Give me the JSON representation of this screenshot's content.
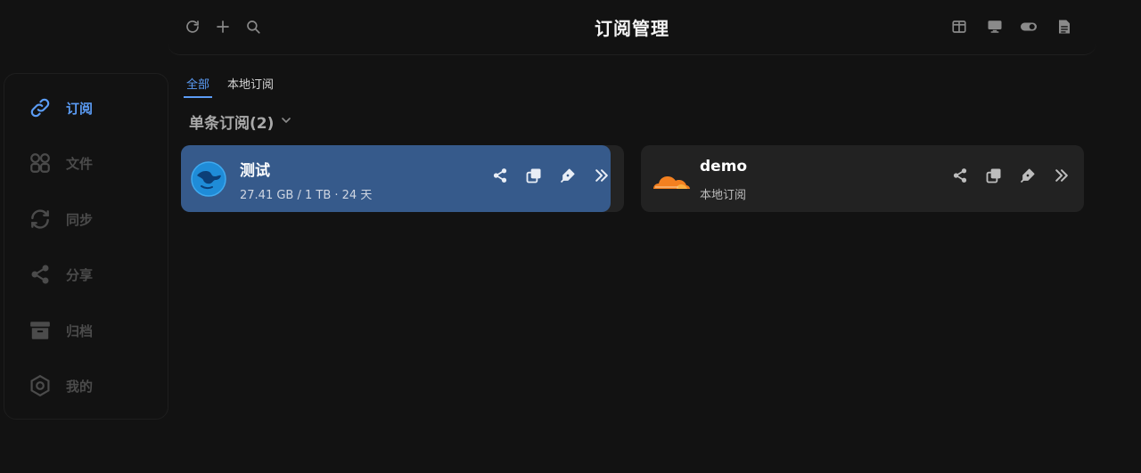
{
  "header": {
    "title": "订阅管理"
  },
  "sidebar": {
    "items": [
      {
        "label": "订阅",
        "icon": "link-icon",
        "active": true
      },
      {
        "label": "文件",
        "icon": "grid-icon",
        "active": false
      },
      {
        "label": "同步",
        "icon": "sync-icon",
        "active": false
      },
      {
        "label": "分享",
        "icon": "share-icon",
        "active": false
      },
      {
        "label": "归档",
        "icon": "archive-icon",
        "active": false
      },
      {
        "label": "我的",
        "icon": "hexagon-icon",
        "active": false
      }
    ]
  },
  "tabs": [
    {
      "label": "全部",
      "active": true
    },
    {
      "label": "本地订阅",
      "active": false
    }
  ],
  "section": {
    "title": "单条订阅(2)"
  },
  "subscriptions": [
    {
      "name": "测试",
      "detail": "27.41 GB / 1 TB · 24 天",
      "icon": "globe-icon"
    },
    {
      "name": "demo",
      "detail": "本地订阅",
      "icon": "cloud-icon"
    }
  ],
  "colors": {
    "accent": "#5b9cf5",
    "selected_card": "#365a8b",
    "card": "#222222",
    "background": "#121212",
    "cloudflare_orange": "#f38020"
  }
}
